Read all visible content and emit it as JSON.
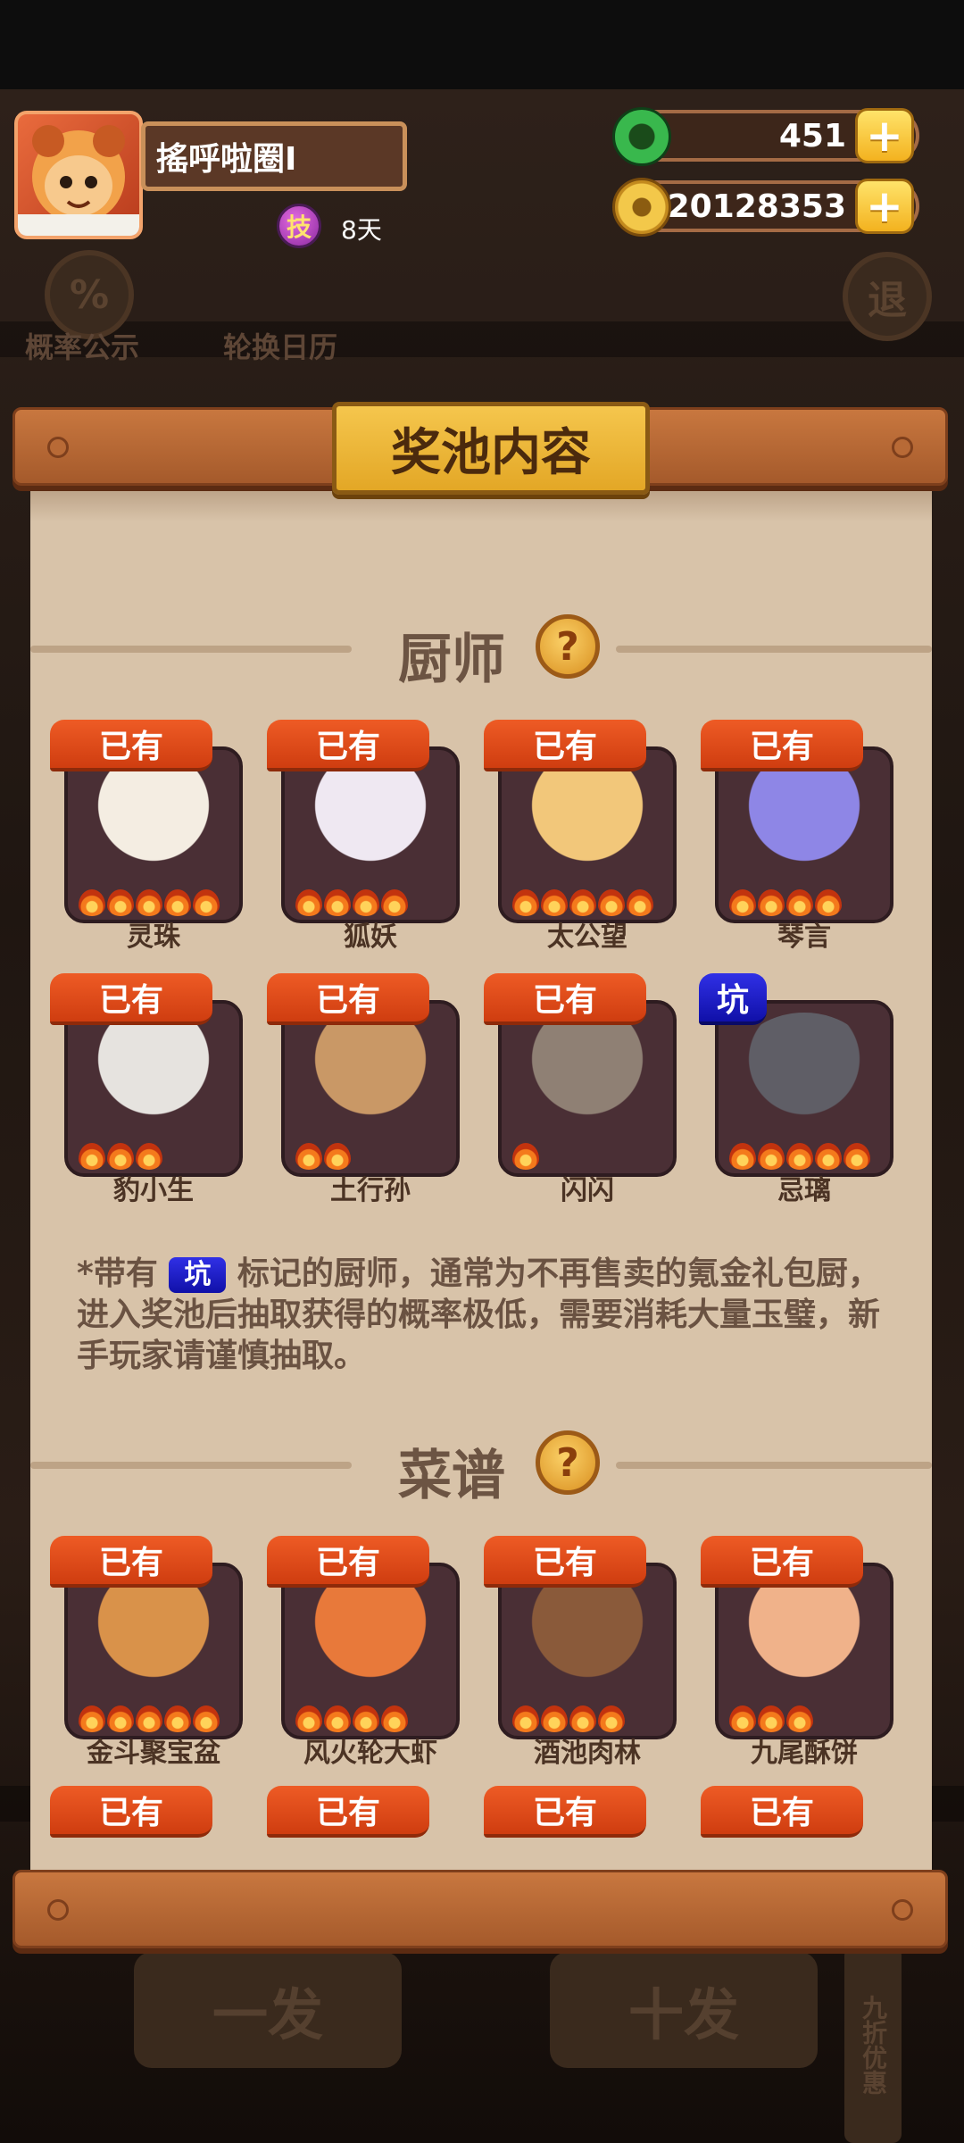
{
  "player": {
    "name": "搖呼啦圈I",
    "skill_icon": "技",
    "skill_days": "8天"
  },
  "currency": {
    "jade": "451",
    "coins": "20128353"
  },
  "background_nav": {
    "probability": "概率公示",
    "calendar": "轮换日历",
    "exit": "退",
    "single": "一发",
    "ten": "十发",
    "discount": "九折优惠"
  },
  "modal": {
    "title": "奖池内容"
  },
  "chefs_section": {
    "title": "厨师",
    "help": "?",
    "items": [
      {
        "tag": "已有",
        "name": "灵珠",
        "stars": 5,
        "color": "#f4ede2"
      },
      {
        "tag": "已有",
        "name": "狐妖",
        "stars": 4,
        "color": "#efe8f2"
      },
      {
        "tag": "已有",
        "name": "太公望",
        "stars": 5,
        "color": "#f2c77a"
      },
      {
        "tag": "已有",
        "name": "琴言",
        "stars": 4,
        "color": "#8e86e6"
      },
      {
        "tag": "已有",
        "name": "豹小生",
        "stars": 3,
        "color": "#e6e3df"
      },
      {
        "tag": "已有",
        "name": "土行孙",
        "stars": 2,
        "color": "#c99866"
      },
      {
        "tag": "已有",
        "name": "闪闪",
        "stars": 1,
        "color": "#8f8074"
      },
      {
        "tag": "坑",
        "name": "忌璃",
        "stars": 5,
        "color": "#5f5e66"
      }
    ]
  },
  "note": {
    "prefix": "*带有",
    "pit": "坑",
    "text": "标记的厨师，通常为不再售卖的氪金礼包厨，进入奖池后抽取获得的概率极低，需要消耗大量玉璧，新手玩家请谨慎抽取。"
  },
  "recipes_section": {
    "title": "菜谱",
    "help": "?",
    "items": [
      {
        "tag": "已有",
        "name": "金斗聚宝盆",
        "stars": 5,
        "color": "#d9924a"
      },
      {
        "tag": "已有",
        "name": "风火轮大虾",
        "stars": 4,
        "color": "#e8793a"
      },
      {
        "tag": "已有",
        "name": "酒池肉林",
        "stars": 4,
        "color": "#8a5a3a"
      },
      {
        "tag": "已有",
        "name": "九尾酥饼",
        "stars": 3,
        "color": "#f0b28a"
      }
    ],
    "next_row_tags": [
      "已有",
      "已有",
      "已有",
      "已有"
    ]
  }
}
